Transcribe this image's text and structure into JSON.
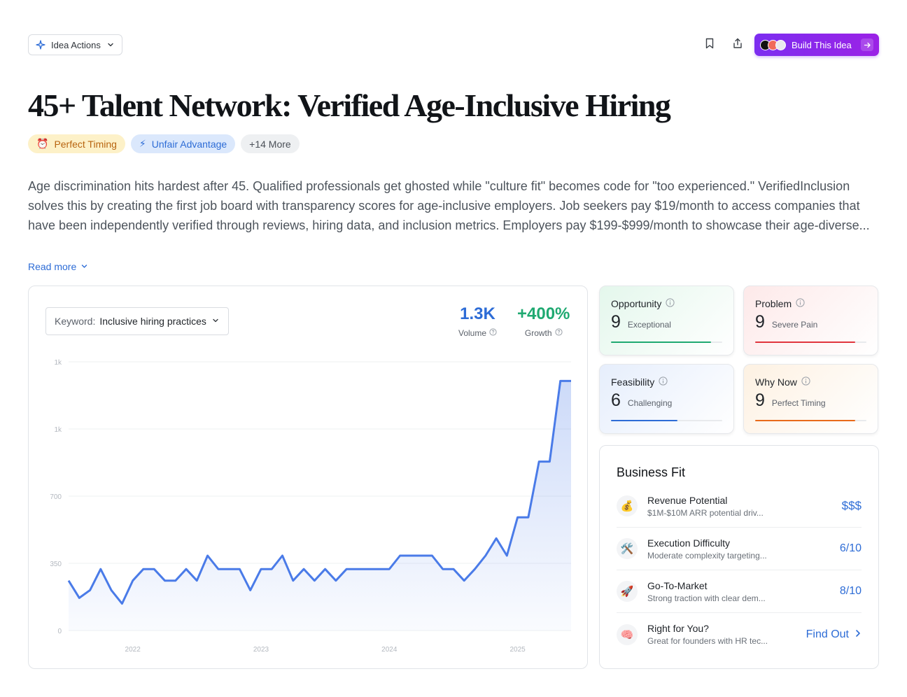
{
  "toolbar": {
    "idea_actions_label": "Idea Actions",
    "build_label": "Build This Idea"
  },
  "title": "45+ Talent Network: Verified Age-Inclusive Hiring",
  "tags": [
    {
      "icon": "⏰",
      "label": "Perfect Timing"
    },
    {
      "icon": "⚡",
      "label": "Unfair Advantage"
    },
    {
      "label": "+14 More"
    }
  ],
  "description": "Age discrimination hits hardest after 45. Qualified professionals get ghosted while \"culture fit\" becomes code for \"too experienced.\" VerifiedInclusion solves this by creating the first job board with transparency scores for age-inclusive employers. Job seekers pay $19/month to access companies that have been independently verified through reviews, hiring data, and inclusion metrics. Employers pay $199-$999/month to showcase their age-diverse...",
  "read_more": "Read more",
  "keyword": {
    "label": "Keyword:",
    "value": "Inclusive hiring practices"
  },
  "metrics": {
    "volume": {
      "value": "1.3K",
      "label": "Volume"
    },
    "growth": {
      "value": "+400%",
      "label": "Growth"
    }
  },
  "chart_data": {
    "type": "area",
    "ylim": [
      0,
      1400
    ],
    "ytick_labels": [
      "0",
      "350",
      "700",
      "1k",
      "1k"
    ],
    "xtick_labels": [
      "2022",
      "2023",
      "2024",
      "2025"
    ],
    "color": "#4a7be8",
    "x": [
      "2021-07",
      "2021-08",
      "2021-09",
      "2021-10",
      "2021-11",
      "2021-12",
      "2022-01",
      "2022-02",
      "2022-03",
      "2022-04",
      "2022-05",
      "2022-06",
      "2022-07",
      "2022-08",
      "2022-09",
      "2022-10",
      "2022-11",
      "2022-12",
      "2023-01",
      "2023-02",
      "2023-03",
      "2023-04",
      "2023-05",
      "2023-06",
      "2023-07",
      "2023-08",
      "2023-09",
      "2023-10",
      "2023-11",
      "2023-12",
      "2024-01",
      "2024-02",
      "2024-03",
      "2024-04",
      "2024-05",
      "2024-06",
      "2024-07",
      "2024-08",
      "2024-09",
      "2024-10",
      "2024-11",
      "2024-12",
      "2025-01",
      "2025-02",
      "2025-03",
      "2025-04",
      "2025-05",
      "2025-06"
    ],
    "values": [
      260,
      170,
      210,
      320,
      210,
      140,
      260,
      320,
      320,
      260,
      260,
      320,
      260,
      390,
      320,
      320,
      320,
      210,
      320,
      320,
      390,
      260,
      320,
      260,
      320,
      260,
      320,
      320,
      320,
      320,
      320,
      390,
      390,
      390,
      390,
      320,
      320,
      260,
      320,
      390,
      480,
      390,
      590,
      590,
      880,
      880,
      1300,
      1300
    ]
  },
  "scores": [
    {
      "label": "Opportunity",
      "value": "9",
      "sub": "Exceptional",
      "fill": 0.9,
      "color": "#1fa971"
    },
    {
      "label": "Problem",
      "value": "9",
      "sub": "Severe Pain",
      "fill": 0.9,
      "color": "#e0353d"
    },
    {
      "label": "Feasibility",
      "value": "6",
      "sub": "Challenging",
      "fill": 0.6,
      "color": "#2d6cd6"
    },
    {
      "label": "Why Now",
      "value": "9",
      "sub": "Perfect Timing",
      "fill": 0.9,
      "color": "#e86a1a"
    }
  ],
  "business_fit": {
    "title": "Business Fit",
    "rows": [
      {
        "icon": "💰",
        "name": "Revenue Potential",
        "sub": "$1M-$10M ARR potential driv...",
        "value": "$$$"
      },
      {
        "icon": "🛠️",
        "name": "Execution Difficulty",
        "sub": "Moderate complexity targeting...",
        "value": "6/10"
      },
      {
        "icon": "🚀",
        "name": "Go-To-Market",
        "sub": "Strong traction with clear dem...",
        "value": "8/10"
      },
      {
        "icon": "🧠",
        "name": "Right for You?",
        "sub": "Great for founders with HR tec...",
        "value": "Find Out"
      }
    ]
  }
}
